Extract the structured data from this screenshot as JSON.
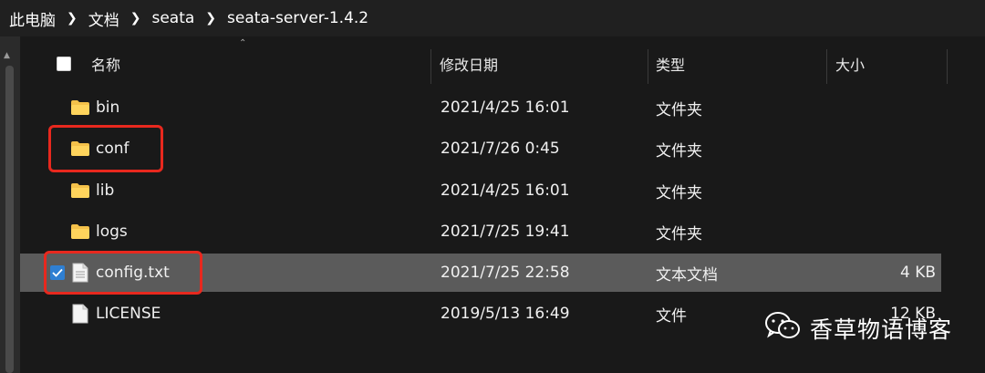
{
  "breadcrumb": [
    "此电脑",
    "文档",
    "seata",
    "seata-server-1.4.2"
  ],
  "columns": {
    "name": "名称",
    "modified": "修改日期",
    "type": "类型",
    "size": "大小"
  },
  "files": [
    {
      "name": "bin",
      "modified": "2021/4/25 16:01",
      "type": "文件夹",
      "size": "",
      "icon": "folder-icon"
    },
    {
      "name": "conf",
      "modified": "2021/7/26 0:45",
      "type": "文件夹",
      "size": "",
      "icon": "folder-icon"
    },
    {
      "name": "lib",
      "modified": "2021/4/25 16:01",
      "type": "文件夹",
      "size": "",
      "icon": "folder-icon"
    },
    {
      "name": "logs",
      "modified": "2021/7/25 19:41",
      "type": "文件夹",
      "size": "",
      "icon": "folder-icon"
    },
    {
      "name": "config.txt",
      "modified": "2021/7/25 22:58",
      "type": "文本文档",
      "size": "4 KB",
      "icon": "text-file-icon",
      "selected": true
    },
    {
      "name": "LICENSE",
      "modified": "2019/5/13 16:49",
      "type": "文件",
      "size": "12 KB",
      "icon": "file-icon"
    }
  ],
  "watermark": {
    "text": "香草物语博客",
    "icon": "wechat-icon"
  },
  "colors": {
    "highlight": "#e8281e",
    "selection": "#5b5b5b",
    "folder": "#f4c14a",
    "check": "#2f7fd2"
  }
}
